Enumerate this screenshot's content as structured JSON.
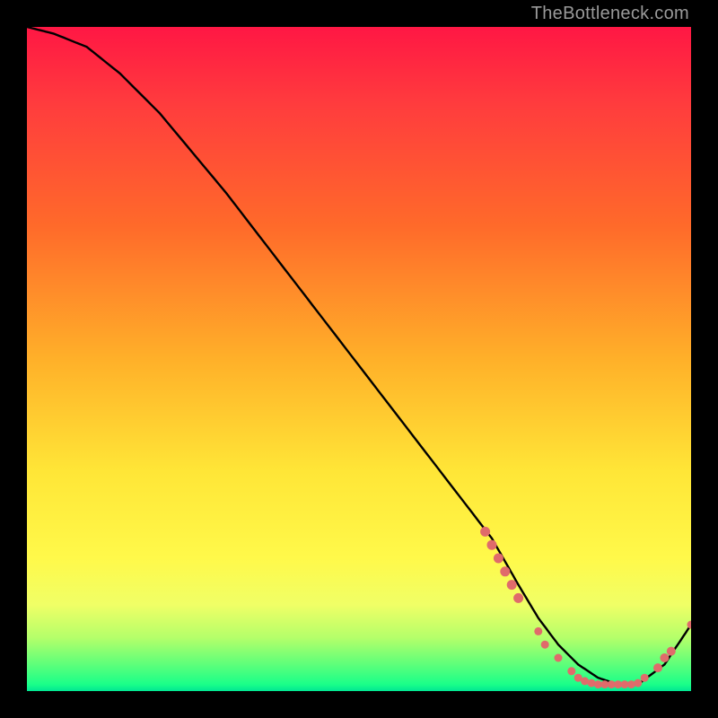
{
  "watermark": "TheBottleneck.com",
  "colors": {
    "background": "#000000",
    "gradient_top": "#ff1744",
    "gradient_mid": "#ffe637",
    "gradient_bottom": "#00e692",
    "curve": "#000000",
    "dots": "#e06b6b",
    "watermark_text": "#9a9a9a"
  },
  "chart_data": {
    "type": "line",
    "title": "",
    "xlabel": "",
    "ylabel": "",
    "xlim": [
      0,
      100
    ],
    "ylim": [
      0,
      100
    ],
    "curve": {
      "x": [
        0,
        4,
        9,
        14,
        20,
        30,
        40,
        50,
        60,
        70,
        74,
        77,
        80,
        83,
        86,
        89,
        92,
        96,
        100
      ],
      "y": [
        100,
        99,
        97,
        93,
        87,
        75,
        62,
        49,
        36,
        23,
        16,
        11,
        7,
        4,
        2,
        1,
        1,
        4,
        10
      ]
    },
    "dots": {
      "description": "salmon marker dots along the curve, clustered near the trough",
      "points": [
        {
          "x": 69,
          "y": 24
        },
        {
          "x": 70,
          "y": 22
        },
        {
          "x": 71,
          "y": 20
        },
        {
          "x": 72,
          "y": 18
        },
        {
          "x": 73,
          "y": 16
        },
        {
          "x": 74,
          "y": 14
        },
        {
          "x": 77,
          "y": 9
        },
        {
          "x": 78,
          "y": 7
        },
        {
          "x": 80,
          "y": 5
        },
        {
          "x": 82,
          "y": 3
        },
        {
          "x": 83,
          "y": 2
        },
        {
          "x": 84,
          "y": 1.5
        },
        {
          "x": 85,
          "y": 1.2
        },
        {
          "x": 86,
          "y": 1
        },
        {
          "x": 87,
          "y": 1
        },
        {
          "x": 88,
          "y": 1
        },
        {
          "x": 89,
          "y": 1
        },
        {
          "x": 90,
          "y": 1
        },
        {
          "x": 91,
          "y": 1
        },
        {
          "x": 92,
          "y": 1.2
        },
        {
          "x": 93,
          "y": 2
        },
        {
          "x": 95,
          "y": 3.5
        },
        {
          "x": 96,
          "y": 5
        },
        {
          "x": 97,
          "y": 6
        },
        {
          "x": 100,
          "y": 10
        }
      ]
    }
  }
}
